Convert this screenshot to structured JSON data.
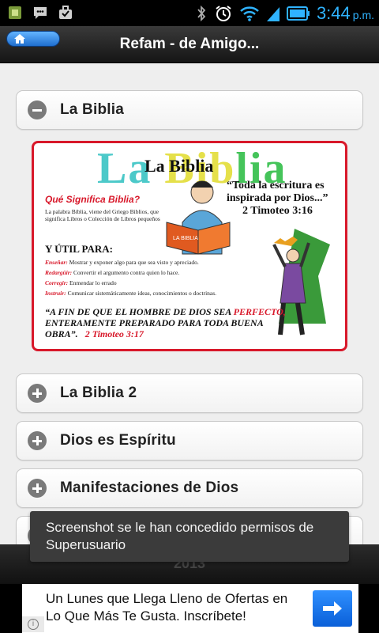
{
  "status_bar": {
    "time": "3:44",
    "ampm": "p.m.",
    "icons": [
      "usb-icon",
      "sms-icon",
      "briefcase-icon",
      "bluetooth-icon",
      "alarm-icon",
      "wifi-icon",
      "signal-icon",
      "battery-icon"
    ]
  },
  "action_bar": {
    "title": "Refam - de Amigo...",
    "home_icon": "home-icon"
  },
  "accordion": {
    "items": [
      {
        "label": "La Biblia",
        "expanded": true
      },
      {
        "label": "La Biblia 2",
        "expanded": false
      },
      {
        "label": "Dios es Espíritu",
        "expanded": false
      },
      {
        "label": "Manifestaciones de Dios",
        "expanded": false
      }
    ]
  },
  "bible_image": {
    "bg_title_1": "La ",
    "bg_title_2": "Bib",
    "bg_title_3": "lia",
    "title": "La Biblia",
    "quote": "“Toda la escritura es inspirada por Dios...”",
    "quote_ref": "2 Timoteo 3:16",
    "question": "Qué Significa Biblia?",
    "description": "La palabra Biblia, viene del Griego Biblios, que significa Libros o Colección de Libros pequeños",
    "util_heading": "Y ÚTIL PARA:",
    "uses": [
      {
        "term": "Enseñar:",
        "text": "Mostrar y exponer algo para que sea visto y apreciado."
      },
      {
        "term": "Redargüir:",
        "text": "Convertir el argumento contra quien lo hace."
      },
      {
        "term": "Corregir:",
        "text": "Enmendar lo errado"
      },
      {
        "term": "Instruir:",
        "text": "Comunicar sistemáticamente ideas, conocimientos o doctrinas."
      }
    ],
    "final_1": "“A FIN DE QUE EL HOMBRE DE DIOS SEA",
    "final_red": "PERFECTO,",
    "final_2": "ENTERAMENTE PREPARADO PARA TODA BUENA OBRA”.",
    "final_ref": "2 Timoteo 3:17",
    "book_label": "LA BIBLIA"
  },
  "toast": {
    "text": "Screenshot se le han concedido permisos de Superusuario"
  },
  "footer": {
    "year": "2013"
  },
  "ad": {
    "text": "Un Lunes que Llega Lleno de Ofertas en Lo Que Más Te Gusta. Inscríbete!",
    "button_icon": "arrow-right-icon",
    "info_icon": "info-icon"
  },
  "colors": {
    "accent_blue": "#2fb3ff",
    "card_border_red": "#d8182a",
    "content_bg": "#eeeeee"
  }
}
